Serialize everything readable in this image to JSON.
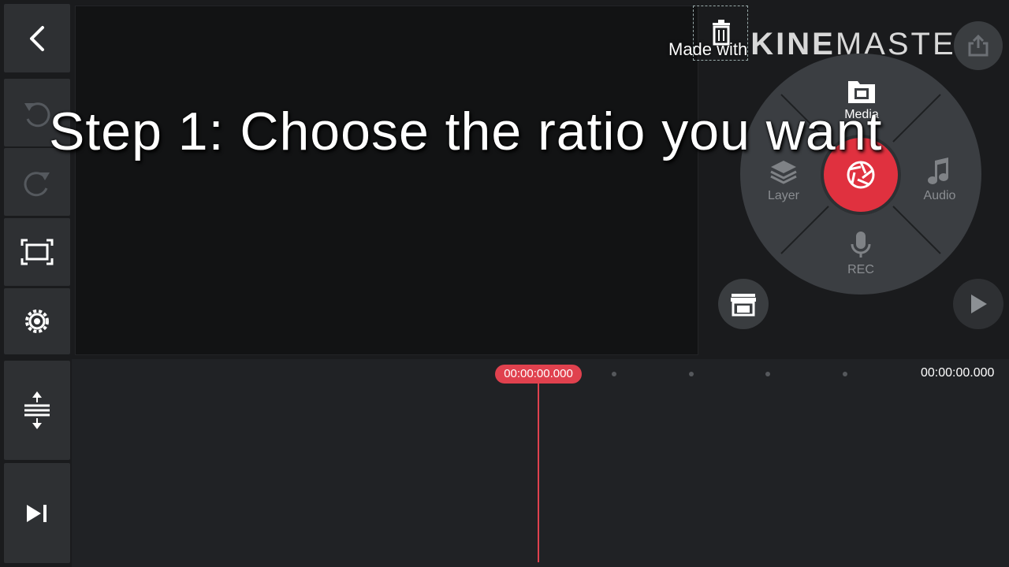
{
  "toolbar": {
    "back": "back-icon",
    "undo": "undo-icon",
    "redo": "redo-icon",
    "fit": "fit-screen-icon",
    "settings": "gear-icon",
    "expand": "expand-tracks-icon",
    "jump_end": "skip-to-end-icon"
  },
  "watermark": {
    "made_with": "Made with",
    "brand_bold": "KINE",
    "brand_light": "MASTER"
  },
  "wheel": {
    "media_label": "Media",
    "layer_label": "Layer",
    "audio_label": "Audio",
    "rec_label": "REC",
    "accent": "#e0313f"
  },
  "caption": "Step 1: Choose the ratio you want",
  "timeline": {
    "playhead_time": "00:00:00.000",
    "end_time": "00:00:00.000",
    "playhead_color": "#e0414e"
  }
}
